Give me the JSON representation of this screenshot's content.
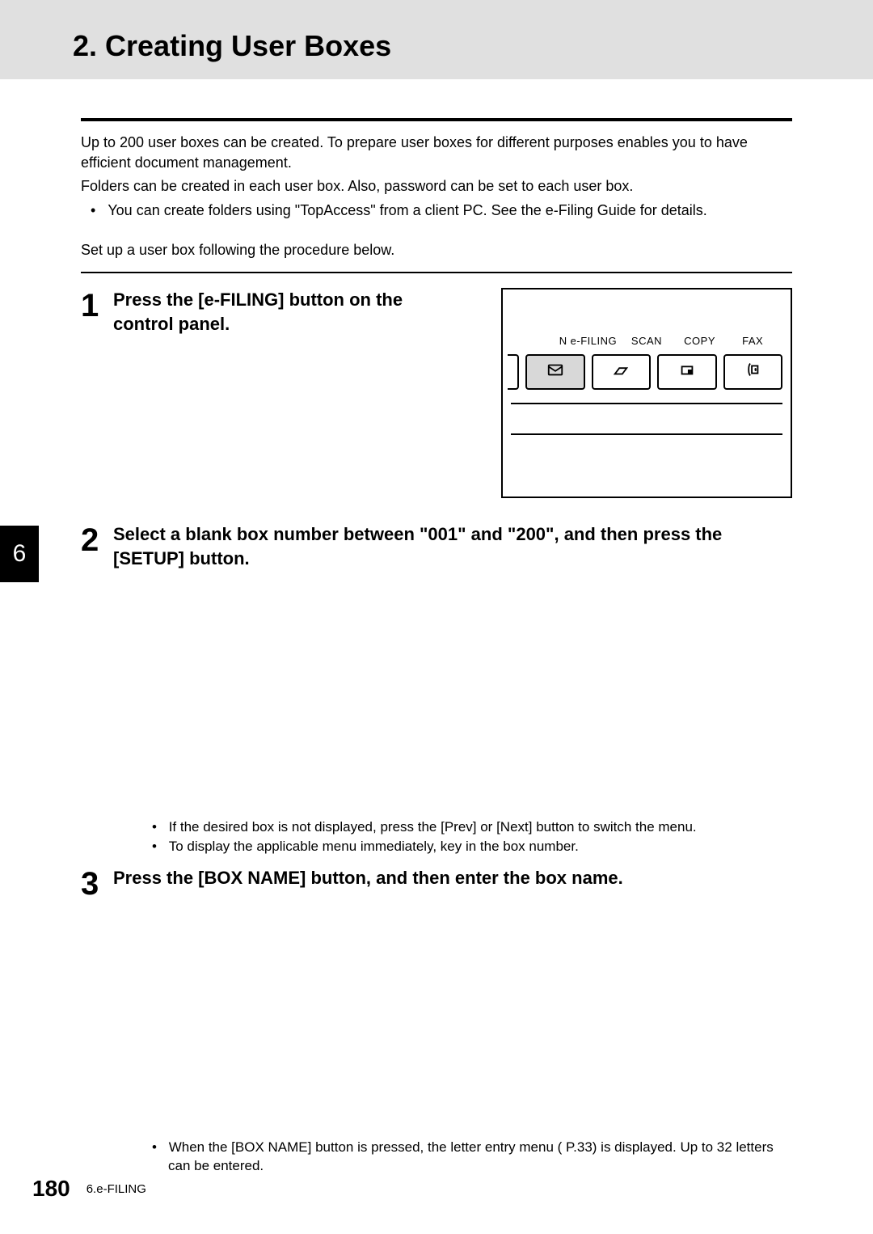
{
  "header": {
    "title": "2. Creating User Boxes"
  },
  "chapter_tab": "6",
  "intro": {
    "p1": "Up to 200 user boxes can be created. To prepare user boxes for different purposes enables you to have efficient document management.",
    "p2": "Folders can be created in each user box. Also, password can be set to each user box.",
    "bullet1": "You can create folders using \"TopAccess\" from a client PC. See the e-Filing Guide for details.",
    "setup_line": "Set up a user box following the procedure below."
  },
  "steps": {
    "s1": {
      "num": "1",
      "title": "Press the [e-FILING] button on the control panel."
    },
    "s2": {
      "num": "2",
      "title": "Select a blank box number between \"001\" and \"200\", and then press the [SETUP] button.",
      "notes": {
        "n1": "If the desired box is not displayed, press the [Prev] or [Next] button to switch the menu.",
        "n2": "To display the applicable menu immediately, key in the box number."
      }
    },
    "s3": {
      "num": "3",
      "title": "Press the [BOX NAME] button, and then enter the box name.",
      "notes": {
        "n1": "When the [BOX NAME] button is pressed, the letter entry menu (   P.33) is displayed. Up to 32 letters can be entered."
      }
    }
  },
  "panel": {
    "edge_label": "N",
    "labels": {
      "l1": "e-FILING",
      "l2": "SCAN",
      "l3": "COPY",
      "l4": "FAX"
    }
  },
  "footer": {
    "page": "180",
    "section": "6.e-FILING"
  }
}
